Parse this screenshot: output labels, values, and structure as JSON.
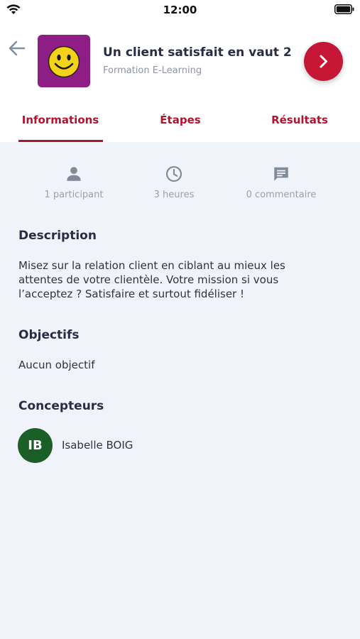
{
  "status_bar": {
    "time": "12:00"
  },
  "header": {
    "title": "Un client satisfait en vaut 2",
    "subtitle": "Formation E-Learning",
    "accent": "#c51635"
  },
  "tabs": [
    {
      "label": "Informations",
      "active": true
    },
    {
      "label": "Étapes",
      "active": false
    },
    {
      "label": "Résultats",
      "active": false
    }
  ],
  "stats": [
    {
      "icon": "person-icon",
      "label": "1 participant"
    },
    {
      "icon": "clock-icon",
      "label": "3 heures"
    },
    {
      "icon": "comment-icon",
      "label": "0 commentaire"
    }
  ],
  "description": {
    "title": "Description",
    "lines": [
      "Misez sur la relation client en ciblant au mieux les",
      "attentes de votre clientèle. Votre mission si vous",
      "l’acceptez ? Satisfaire et surtout fidéliser !"
    ]
  },
  "objectives": {
    "title": "Objectifs",
    "text": "Aucun objectif"
  },
  "designers": {
    "title": "Concepteurs",
    "items": [
      {
        "initials": "IB",
        "name": "Isabelle BOIG",
        "color": "#1c5e27"
      }
    ]
  }
}
